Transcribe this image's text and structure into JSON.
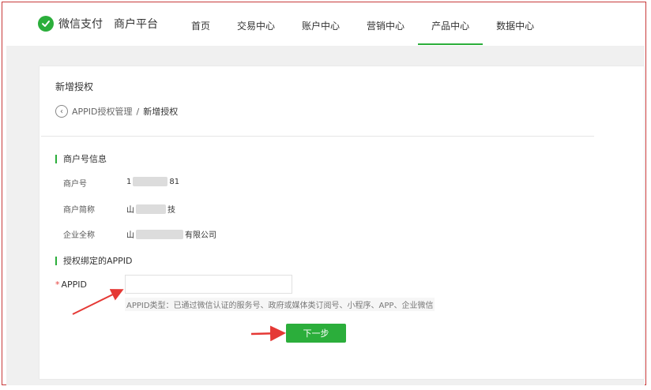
{
  "header": {
    "brand": "微信支付",
    "subtitle": "商户平台",
    "nav": [
      {
        "label": "首页",
        "active": false
      },
      {
        "label": "交易中心",
        "active": false
      },
      {
        "label": "账户中心",
        "active": false
      },
      {
        "label": "营销中心",
        "active": false
      },
      {
        "label": "产品中心",
        "active": true
      },
      {
        "label": "数据中心",
        "active": false
      }
    ]
  },
  "page": {
    "title": "新增授权",
    "breadcrumb": {
      "parent": "APPID授权管理",
      "separator": "/",
      "current": "新增授权"
    }
  },
  "merchant_section": {
    "title": "商户号信息",
    "rows": [
      {
        "label": "商户号",
        "value_prefix": "1",
        "value_suffix": "81"
      },
      {
        "label": "商户简称",
        "value_prefix": "山",
        "value_suffix": "技"
      },
      {
        "label": "企业全称",
        "value_prefix": "山",
        "value_suffix": "有限公司"
      }
    ]
  },
  "appid_section": {
    "title": "授权绑定的APPID",
    "field_label": "APPID",
    "required_mark": "*",
    "input_value": "",
    "hint": "APPID类型：已通过微信认证的服务号、政府或媒体类订阅号、小程序、APP、企业微信"
  },
  "actions": {
    "next_label": "下一步"
  },
  "colors": {
    "accent": "#2bae3b",
    "annotation_arrow": "#e53935",
    "frame_border": "#c83a3a"
  }
}
